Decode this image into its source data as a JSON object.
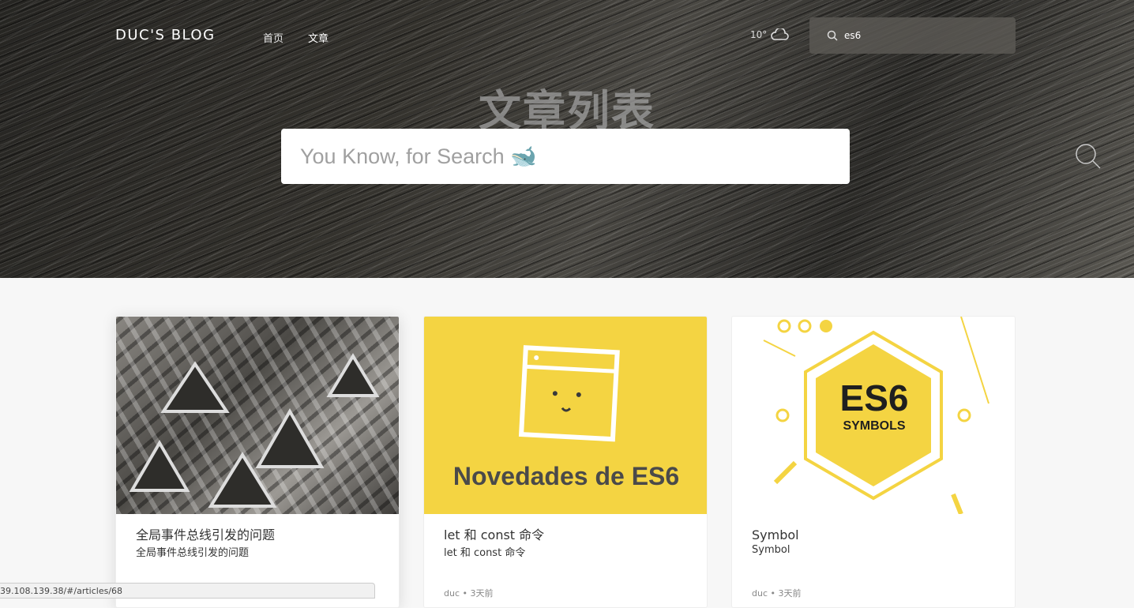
{
  "nav": {
    "logo": "DUC'S BLOG",
    "links": [
      "首页",
      "文章"
    ],
    "weather": "10°",
    "search_value": "es6"
  },
  "hero": {
    "title": "文章列表",
    "search_placeholder": "You Know, for Search 🐋"
  },
  "articles": [
    {
      "title": "全局事件总线引发的问题",
      "summary": "全局事件总线引发的问题",
      "author": "",
      "time": ""
    },
    {
      "title": "let 和 const 命令",
      "summary": "let 和 const 命令",
      "image_text": "Novedades de ES6",
      "author": "duc",
      "time": "• 3天前"
    },
    {
      "title": "Symbol",
      "summary": "Symbol",
      "image_text_main": "ES6",
      "image_text_sub": "SYMBOLS",
      "author": "duc",
      "time": "• 3天前"
    }
  ],
  "status_bar": {
    "url": "39.108.139.38/#/articles/68"
  },
  "colors": {
    "accent_yellow": "#f4d442",
    "hero_dark": "#2c2b28"
  }
}
